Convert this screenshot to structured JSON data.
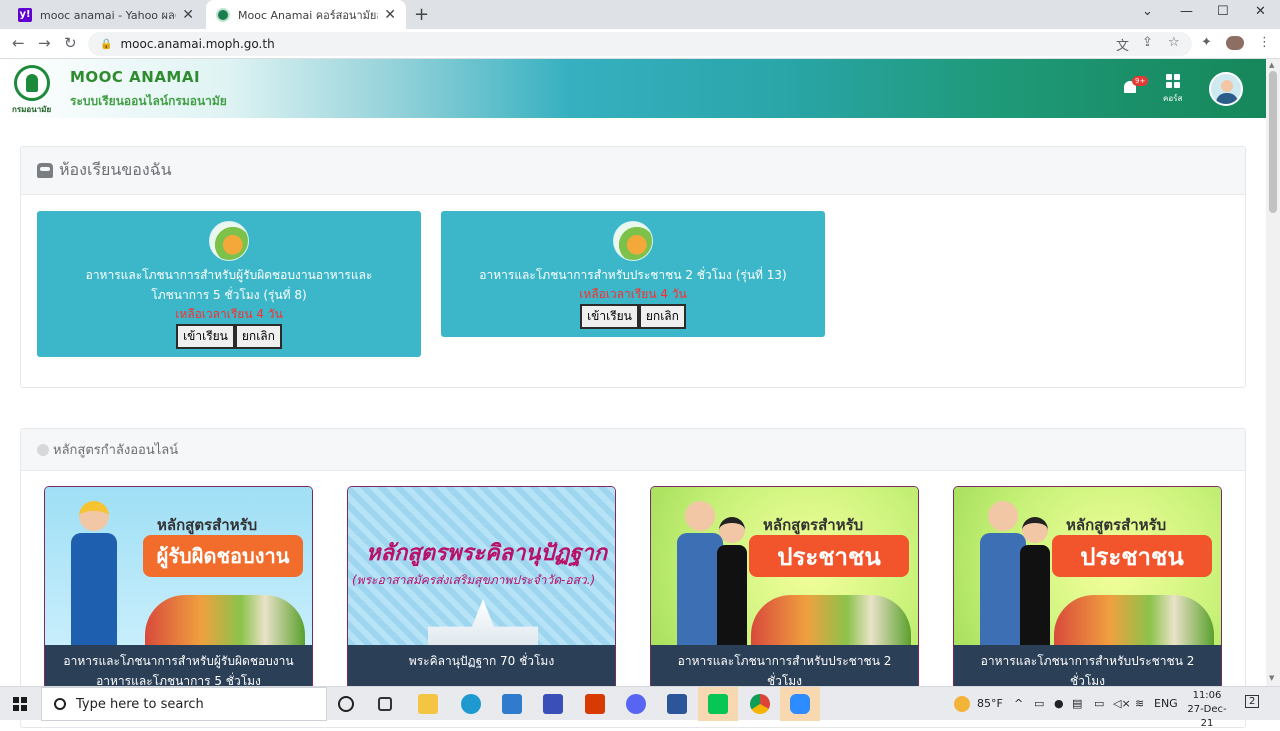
{
  "browser": {
    "tabs": [
      {
        "title": "mooc anamai - Yahoo ผลค้นหาการ",
        "favicon": "yahoo-icon"
      },
      {
        "title": "Mooc Anamai คอร์สอนามัยออนไลน์",
        "favicon": "anamai-icon"
      }
    ],
    "url": "mooc.anamai.moph.go.th"
  },
  "site": {
    "title": "MOOC ANAMAI",
    "subtitle": "ระบบเรียนออนไลน์กรมอนามัย",
    "logo_caption": "กรมอนามัย",
    "notification_badge": "9+",
    "courses_label": "คอร์ส"
  },
  "my_classes": {
    "heading": "ห้องเรียนของฉัน",
    "cards": [
      {
        "title": "อาหารและโภชนาการสำหรับผู้รับผิดชอบงานอาหารและโภชนาการ 5 ชั่วโมง (รุ่นที่ 8)",
        "remaining": "เหลือเวลาเรียน 4 วัน",
        "enter_label": "เข้าเรียน",
        "cancel_label": "ยกเลิก"
      },
      {
        "title": "อาหารและโภชนาการสำหรับประชาชน 2 ชั่วโมง (รุ่นที่ 13)",
        "remaining": "เหลือเวลาเรียน 4 วัน",
        "enter_label": "เข้าเรียน",
        "cancel_label": "ยกเลิก"
      }
    ]
  },
  "online_courses": {
    "heading": "หลักสูตรกำลังออนไลน์",
    "cards": [
      {
        "badge_top": "หลักสูตรสำหรับ",
        "badge_main": "ผู้รับผิดชอบงาน",
        "caption": "อาหารและโภชนาการสำหรับผู้รับผิดชอบงานอาหารและโภชนาการ 5 ชั่วโมง"
      },
      {
        "badge_top": "หลักสูตรพระคิลานุปัฏฐาก",
        "badge_main": "(พระอาสาสมัครส่งเสริมสุขภาพประจำวัด-อสว.)",
        "caption": "พระคิลานุปัฏฐาก 70 ชั่วโมง"
      },
      {
        "badge_top": "หลักสูตรสำหรับ",
        "badge_main": "ประชาชน",
        "caption": "อาหารและโภชนาการสำหรับประชาชน 2 ชั่วโมง"
      },
      {
        "badge_top": "หลักสูตรสำหรับ",
        "badge_main": "ประชาชน",
        "caption": "อาหารและโภชนาการสำหรับประชาชน 2 ชั่วโมง"
      }
    ]
  },
  "taskbar": {
    "search_placeholder": "Type here to search",
    "temperature": "85°F",
    "language": "ENG",
    "time": "11:06",
    "date": "27-Dec-21",
    "notification_count": "2"
  },
  "colors": {
    "card_bg": "#3bb7c9",
    "remaining_text": "#ff2d2d",
    "caption_bg": "#2b3f57"
  }
}
